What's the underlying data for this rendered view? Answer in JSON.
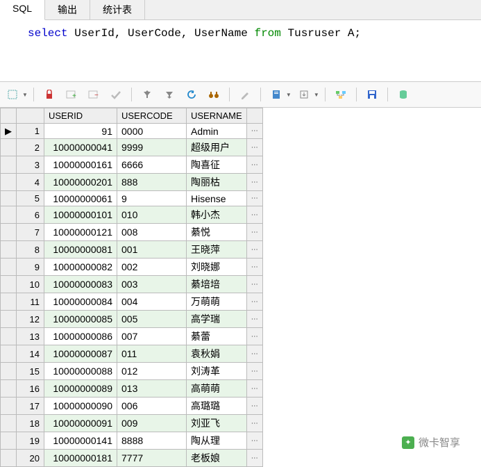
{
  "tabs": {
    "sql": "SQL",
    "output": "输出",
    "stats": "统计表"
  },
  "sql": {
    "kw_select": "select",
    "fields": "UserId, UserCode, UserName",
    "kw_from": "from",
    "table": "Tusruser A;"
  },
  "columns": {
    "userid": "USERID",
    "usercode": "USERCODE",
    "username": "USERNAME"
  },
  "rows": [
    {
      "n": 1,
      "userid": "91",
      "usercode": "0000",
      "username": "Admin"
    },
    {
      "n": 2,
      "userid": "10000000041",
      "usercode": "9999",
      "username": "超级用户"
    },
    {
      "n": 3,
      "userid": "10000000161",
      "usercode": "6666",
      "username": "陶喜征"
    },
    {
      "n": 4,
      "userid": "10000000201",
      "usercode": "888",
      "username": "陶丽枯"
    },
    {
      "n": 5,
      "userid": "10000000061",
      "usercode": "9",
      "username": "Hisense"
    },
    {
      "n": 6,
      "userid": "10000000101",
      "usercode": "010",
      "username": "韩小杰"
    },
    {
      "n": 7,
      "userid": "10000000121",
      "usercode": "008",
      "username": "綦悦"
    },
    {
      "n": 8,
      "userid": "10000000081",
      "usercode": "001",
      "username": "王晓萍"
    },
    {
      "n": 9,
      "userid": "10000000082",
      "usercode": "002",
      "username": "刘晓娜"
    },
    {
      "n": 10,
      "userid": "10000000083",
      "usercode": "003",
      "username": "綦培培"
    },
    {
      "n": 11,
      "userid": "10000000084",
      "usercode": "004",
      "username": "万萌萌"
    },
    {
      "n": 12,
      "userid": "10000000085",
      "usercode": "005",
      "username": "高学瑞"
    },
    {
      "n": 13,
      "userid": "10000000086",
      "usercode": "007",
      "username": "綦蕾"
    },
    {
      "n": 14,
      "userid": "10000000087",
      "usercode": "011",
      "username": "袁秋娟"
    },
    {
      "n": 15,
      "userid": "10000000088",
      "usercode": "012",
      "username": "刘涛革"
    },
    {
      "n": 16,
      "userid": "10000000089",
      "usercode": "013",
      "username": "高萌萌"
    },
    {
      "n": 17,
      "userid": "10000000090",
      "usercode": "006",
      "username": "高璐璐"
    },
    {
      "n": 18,
      "userid": "10000000091",
      "usercode": "009",
      "username": "刘亚飞"
    },
    {
      "n": 19,
      "userid": "10000000141",
      "usercode": "8888",
      "username": "陶从理"
    },
    {
      "n": 20,
      "userid": "10000000181",
      "usercode": "7777",
      "username": "老板娘"
    }
  ],
  "watermark": "微卡智享",
  "chart_data": {
    "type": "table",
    "columns": [
      "USERID",
      "USERCODE",
      "USERNAME"
    ],
    "title": "select UserId, UserCode, UserName from Tusruser A;",
    "rows": [
      [
        "91",
        "0000",
        "Admin"
      ],
      [
        "10000000041",
        "9999",
        "超级用户"
      ],
      [
        "10000000161",
        "6666",
        "陶喜征"
      ],
      [
        "10000000201",
        "888",
        "陶丽枯"
      ],
      [
        "10000000061",
        "9",
        "Hisense"
      ],
      [
        "10000000101",
        "010",
        "韩小杰"
      ],
      [
        "10000000121",
        "008",
        "綦悦"
      ],
      [
        "10000000081",
        "001",
        "王晓萍"
      ],
      [
        "10000000082",
        "002",
        "刘晓娜"
      ],
      [
        "10000000083",
        "003",
        "綦培培"
      ],
      [
        "10000000084",
        "004",
        "万萌萌"
      ],
      [
        "10000000085",
        "005",
        "高学瑞"
      ],
      [
        "10000000086",
        "007",
        "綦蕾"
      ],
      [
        "10000000087",
        "011",
        "袁秋娟"
      ],
      [
        "10000000088",
        "012",
        "刘涛革"
      ],
      [
        "10000000089",
        "013",
        "高萌萌"
      ],
      [
        "10000000090",
        "006",
        "高璐璐"
      ],
      [
        "10000000091",
        "009",
        "刘亚飞"
      ],
      [
        "10000000141",
        "8888",
        "陶从理"
      ],
      [
        "10000000181",
        "7777",
        "老板娘"
      ]
    ]
  }
}
